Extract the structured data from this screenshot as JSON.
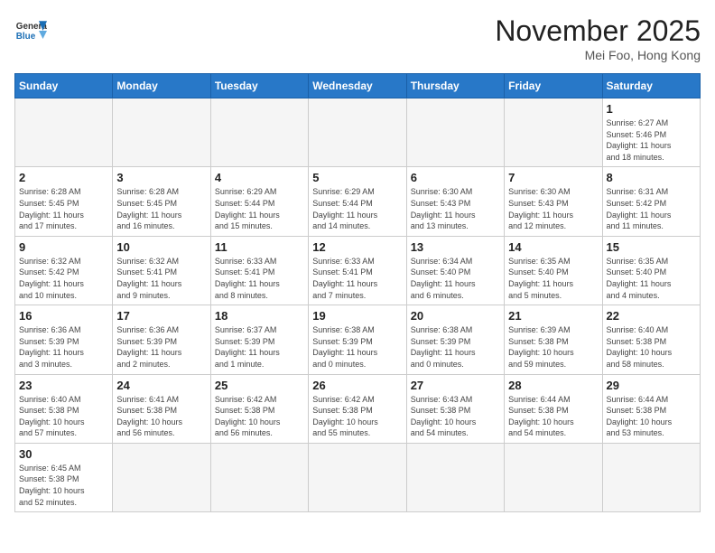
{
  "header": {
    "logo_general": "General",
    "logo_blue": "Blue",
    "month_title": "November 2025",
    "location": "Mei Foo, Hong Kong"
  },
  "weekdays": [
    "Sunday",
    "Monday",
    "Tuesday",
    "Wednesday",
    "Thursday",
    "Friday",
    "Saturday"
  ],
  "weeks": [
    [
      {
        "day": "",
        "info": ""
      },
      {
        "day": "",
        "info": ""
      },
      {
        "day": "",
        "info": ""
      },
      {
        "day": "",
        "info": ""
      },
      {
        "day": "",
        "info": ""
      },
      {
        "day": "",
        "info": ""
      },
      {
        "day": "1",
        "info": "Sunrise: 6:27 AM\nSunset: 5:46 PM\nDaylight: 11 hours\nand 18 minutes."
      }
    ],
    [
      {
        "day": "2",
        "info": "Sunrise: 6:28 AM\nSunset: 5:45 PM\nDaylight: 11 hours\nand 17 minutes."
      },
      {
        "day": "3",
        "info": "Sunrise: 6:28 AM\nSunset: 5:45 PM\nDaylight: 11 hours\nand 16 minutes."
      },
      {
        "day": "4",
        "info": "Sunrise: 6:29 AM\nSunset: 5:44 PM\nDaylight: 11 hours\nand 15 minutes."
      },
      {
        "day": "5",
        "info": "Sunrise: 6:29 AM\nSunset: 5:44 PM\nDaylight: 11 hours\nand 14 minutes."
      },
      {
        "day": "6",
        "info": "Sunrise: 6:30 AM\nSunset: 5:43 PM\nDaylight: 11 hours\nand 13 minutes."
      },
      {
        "day": "7",
        "info": "Sunrise: 6:30 AM\nSunset: 5:43 PM\nDaylight: 11 hours\nand 12 minutes."
      },
      {
        "day": "8",
        "info": "Sunrise: 6:31 AM\nSunset: 5:42 PM\nDaylight: 11 hours\nand 11 minutes."
      }
    ],
    [
      {
        "day": "9",
        "info": "Sunrise: 6:32 AM\nSunset: 5:42 PM\nDaylight: 11 hours\nand 10 minutes."
      },
      {
        "day": "10",
        "info": "Sunrise: 6:32 AM\nSunset: 5:41 PM\nDaylight: 11 hours\nand 9 minutes."
      },
      {
        "day": "11",
        "info": "Sunrise: 6:33 AM\nSunset: 5:41 PM\nDaylight: 11 hours\nand 8 minutes."
      },
      {
        "day": "12",
        "info": "Sunrise: 6:33 AM\nSunset: 5:41 PM\nDaylight: 11 hours\nand 7 minutes."
      },
      {
        "day": "13",
        "info": "Sunrise: 6:34 AM\nSunset: 5:40 PM\nDaylight: 11 hours\nand 6 minutes."
      },
      {
        "day": "14",
        "info": "Sunrise: 6:35 AM\nSunset: 5:40 PM\nDaylight: 11 hours\nand 5 minutes."
      },
      {
        "day": "15",
        "info": "Sunrise: 6:35 AM\nSunset: 5:40 PM\nDaylight: 11 hours\nand 4 minutes."
      }
    ],
    [
      {
        "day": "16",
        "info": "Sunrise: 6:36 AM\nSunset: 5:39 PM\nDaylight: 11 hours\nand 3 minutes."
      },
      {
        "day": "17",
        "info": "Sunrise: 6:36 AM\nSunset: 5:39 PM\nDaylight: 11 hours\nand 2 minutes."
      },
      {
        "day": "18",
        "info": "Sunrise: 6:37 AM\nSunset: 5:39 PM\nDaylight: 11 hours\nand 1 minute."
      },
      {
        "day": "19",
        "info": "Sunrise: 6:38 AM\nSunset: 5:39 PM\nDaylight: 11 hours\nand 0 minutes."
      },
      {
        "day": "20",
        "info": "Sunrise: 6:38 AM\nSunset: 5:39 PM\nDaylight: 11 hours\nand 0 minutes."
      },
      {
        "day": "21",
        "info": "Sunrise: 6:39 AM\nSunset: 5:38 PM\nDaylight: 10 hours\nand 59 minutes."
      },
      {
        "day": "22",
        "info": "Sunrise: 6:40 AM\nSunset: 5:38 PM\nDaylight: 10 hours\nand 58 minutes."
      }
    ],
    [
      {
        "day": "23",
        "info": "Sunrise: 6:40 AM\nSunset: 5:38 PM\nDaylight: 10 hours\nand 57 minutes."
      },
      {
        "day": "24",
        "info": "Sunrise: 6:41 AM\nSunset: 5:38 PM\nDaylight: 10 hours\nand 56 minutes."
      },
      {
        "day": "25",
        "info": "Sunrise: 6:42 AM\nSunset: 5:38 PM\nDaylight: 10 hours\nand 56 minutes."
      },
      {
        "day": "26",
        "info": "Sunrise: 6:42 AM\nSunset: 5:38 PM\nDaylight: 10 hours\nand 55 minutes."
      },
      {
        "day": "27",
        "info": "Sunrise: 6:43 AM\nSunset: 5:38 PM\nDaylight: 10 hours\nand 54 minutes."
      },
      {
        "day": "28",
        "info": "Sunrise: 6:44 AM\nSunset: 5:38 PM\nDaylight: 10 hours\nand 54 minutes."
      },
      {
        "day": "29",
        "info": "Sunrise: 6:44 AM\nSunset: 5:38 PM\nDaylight: 10 hours\nand 53 minutes."
      }
    ],
    [
      {
        "day": "30",
        "info": "Sunrise: 6:45 AM\nSunset: 5:38 PM\nDaylight: 10 hours\nand 52 minutes."
      },
      {
        "day": "",
        "info": ""
      },
      {
        "day": "",
        "info": ""
      },
      {
        "day": "",
        "info": ""
      },
      {
        "day": "",
        "info": ""
      },
      {
        "day": "",
        "info": ""
      },
      {
        "day": "",
        "info": ""
      }
    ]
  ]
}
